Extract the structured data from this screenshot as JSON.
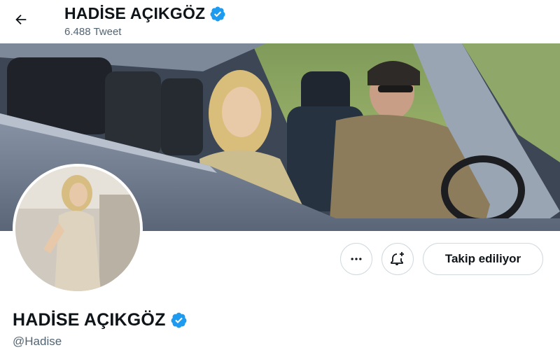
{
  "header": {
    "name": "HADİSE AÇIKGÖZ",
    "tweet_count": "6.488",
    "tweet_label": "Tweet"
  },
  "profile": {
    "name": "HADİSE AÇIKGÖZ",
    "handle": "@Hadise"
  },
  "actions": {
    "more_icon": "more-horizontal-icon",
    "notify_icon": "bell-plus-icon",
    "follow_label": "Takip ediliyor"
  },
  "colors": {
    "verified_blue": "#1d9bf0",
    "secondary_text": "#536471",
    "border": "#cfd9de"
  }
}
